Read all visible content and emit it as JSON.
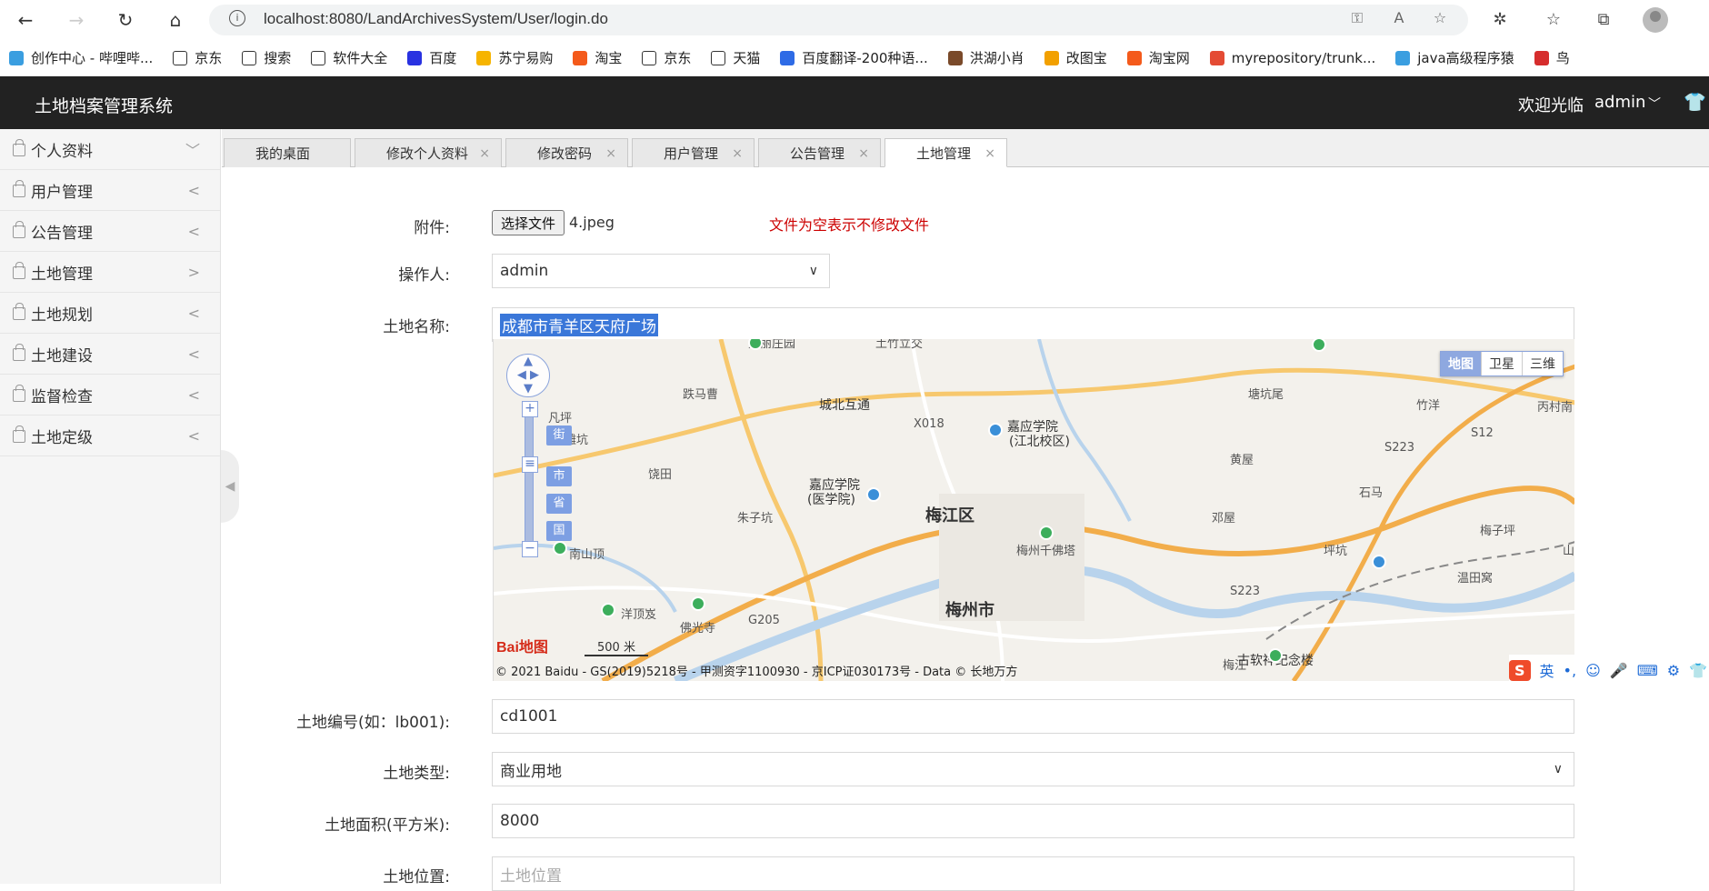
{
  "browser": {
    "url": "localhost:8080/LandArchivesSystem/User/login.do"
  },
  "bookmarks": [
    {
      "label": "创作中心 - 哔哩哔...",
      "color": "#3a9ee0"
    },
    {
      "label": "京东",
      "color": "#ffffff"
    },
    {
      "label": "搜索",
      "color": "#ffffff"
    },
    {
      "label": "软件大全",
      "color": "#ffffff"
    },
    {
      "label": "百度",
      "color": "#2932e1"
    },
    {
      "label": "苏宁易购",
      "color": "#f6b400"
    },
    {
      "label": "淘宝",
      "color": "#f45a1b"
    },
    {
      "label": "京东",
      "color": "#ffffff"
    },
    {
      "label": "天猫",
      "color": "#ffffff"
    },
    {
      "label": "百度翻译-200种语...",
      "color": "#2e6be6"
    },
    {
      "label": "洪湖小肖",
      "color": "#7a4a2a"
    },
    {
      "label": "改图宝",
      "color": "#f2a000"
    },
    {
      "label": "淘宝网",
      "color": "#f45a1b"
    },
    {
      "label": "myrepository/trunk...",
      "color": "#e44b34"
    },
    {
      "label": "java高级程序猿",
      "color": "#3a9ee0"
    },
    {
      "label": "鸟",
      "color": "#d62d2d"
    }
  ],
  "header": {
    "title": "土地档案管理系统",
    "welcome": "欢迎光临",
    "user": "admin"
  },
  "sidebar": {
    "items": [
      {
        "label": "个人资料",
        "arrow": "﹀"
      },
      {
        "label": "用户管理",
        "arrow": "<"
      },
      {
        "label": "公告管理",
        "arrow": "<"
      },
      {
        "label": "土地管理",
        "arrow": ">"
      },
      {
        "label": "土地规划",
        "arrow": "<"
      },
      {
        "label": "土地建设",
        "arrow": "<"
      },
      {
        "label": "监督检查",
        "arrow": "<"
      },
      {
        "label": "土地定级",
        "arrow": "<"
      }
    ]
  },
  "tabs": [
    {
      "label": "我的桌面"
    },
    {
      "label": "修改个人资料"
    },
    {
      "label": "修改密码"
    },
    {
      "label": "用户管理"
    },
    {
      "label": "公告管理"
    },
    {
      "label": "土地管理"
    }
  ],
  "form": {
    "attachment_label": "附件:",
    "file_button": "选择文件",
    "file_name": "4.jpeg",
    "file_hint": "文件为空表示不修改文件",
    "operator_label": "操作人:",
    "operator_value": "admin",
    "landname_label": "土地名称:",
    "landname_value": "成都市青羊区天府广场",
    "landno_label": "土地编号(如：lb001):",
    "landno_value": "cd1001",
    "landtype_label": "土地类型:",
    "landtype_value": "商业用地",
    "landarea_label": "土地面积(平方米):",
    "landarea_value": "8000",
    "landpos_label": "土地位置:",
    "landpos_placeholder": "土地位置"
  },
  "map": {
    "types": [
      "地图",
      "卫星",
      "三维"
    ],
    "levels": [
      "街",
      "市",
      "省",
      "国"
    ],
    "labels": [
      "爱丽庄园",
      "土竹立交",
      "跌马曹",
      "城北互通",
      "X018",
      "塘坑尾",
      "竹洋",
      "丙村南",
      "凡坪",
      "滩坑",
      "嘉应学院",
      "(江北校区)",
      "饶田",
      "黄屋",
      "S223",
      "S12",
      "嘉应学院",
      "(医学院)",
      "梅江区",
      "邓屋",
      "石马",
      "朱子坑",
      "梅州千佛塔",
      "梅子坪",
      "南山顶",
      "坪坑",
      "温田窝",
      "山方",
      "洋顶岌",
      "佛光寺",
      "G205",
      "梅州市",
      "S223",
      "梅江",
      "古软祥纪念楼"
    ],
    "scale": "500 米",
    "copyright": "© 2021 Baidu - GS(2019)5218号 - 甲测资字1100930 - 京ICP证030173号 - Data © 长地万方",
    "logo": "Bai地图"
  },
  "ime": {
    "logo": "S",
    "mode": "英"
  }
}
